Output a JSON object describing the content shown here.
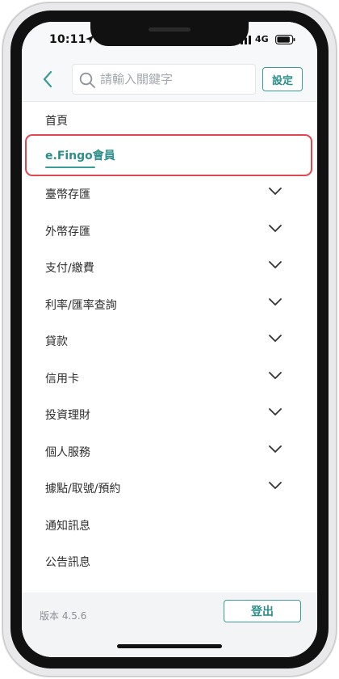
{
  "status_bar": {
    "time": "10:11",
    "network": "4G",
    "icons": [
      "location-arrow-icon",
      "signal-bars-icon",
      "battery-icon"
    ]
  },
  "header": {
    "back_icon": "chevron-left-icon",
    "search_icon": "search-icon",
    "search_placeholder": "請輸入關鍵字",
    "search_value": "",
    "settings_label": "設定"
  },
  "menu": {
    "items": [
      {
        "label": "首頁",
        "expandable": false
      },
      {
        "label": "e.Fingo會員",
        "expandable": false,
        "active": true
      },
      {
        "label": "臺幣存匯",
        "expandable": true
      },
      {
        "label": "外幣存匯",
        "expandable": true
      },
      {
        "label": "支付/繳費",
        "expandable": true
      },
      {
        "label": "利率/匯率查詢",
        "expandable": true
      },
      {
        "label": "貸款",
        "expandable": true
      },
      {
        "label": "信用卡",
        "expandable": true
      },
      {
        "label": "投資理財",
        "expandable": true
      },
      {
        "label": "個人服務",
        "expandable": true
      },
      {
        "label": "據點/取號/預約",
        "expandable": true
      },
      {
        "label": "通知訊息",
        "expandable": false
      },
      {
        "label": "公告訊息",
        "expandable": false
      }
    ],
    "chevron_icon": "chevron-down-icon"
  },
  "footer": {
    "version": "版本 4.5.6",
    "logout_label": "登出"
  },
  "colors": {
    "accent": "#2d8e8a",
    "highlight_border": "#e0474e",
    "header_bg": "#f6f8fa",
    "footer_bg": "#f3f4f6"
  }
}
